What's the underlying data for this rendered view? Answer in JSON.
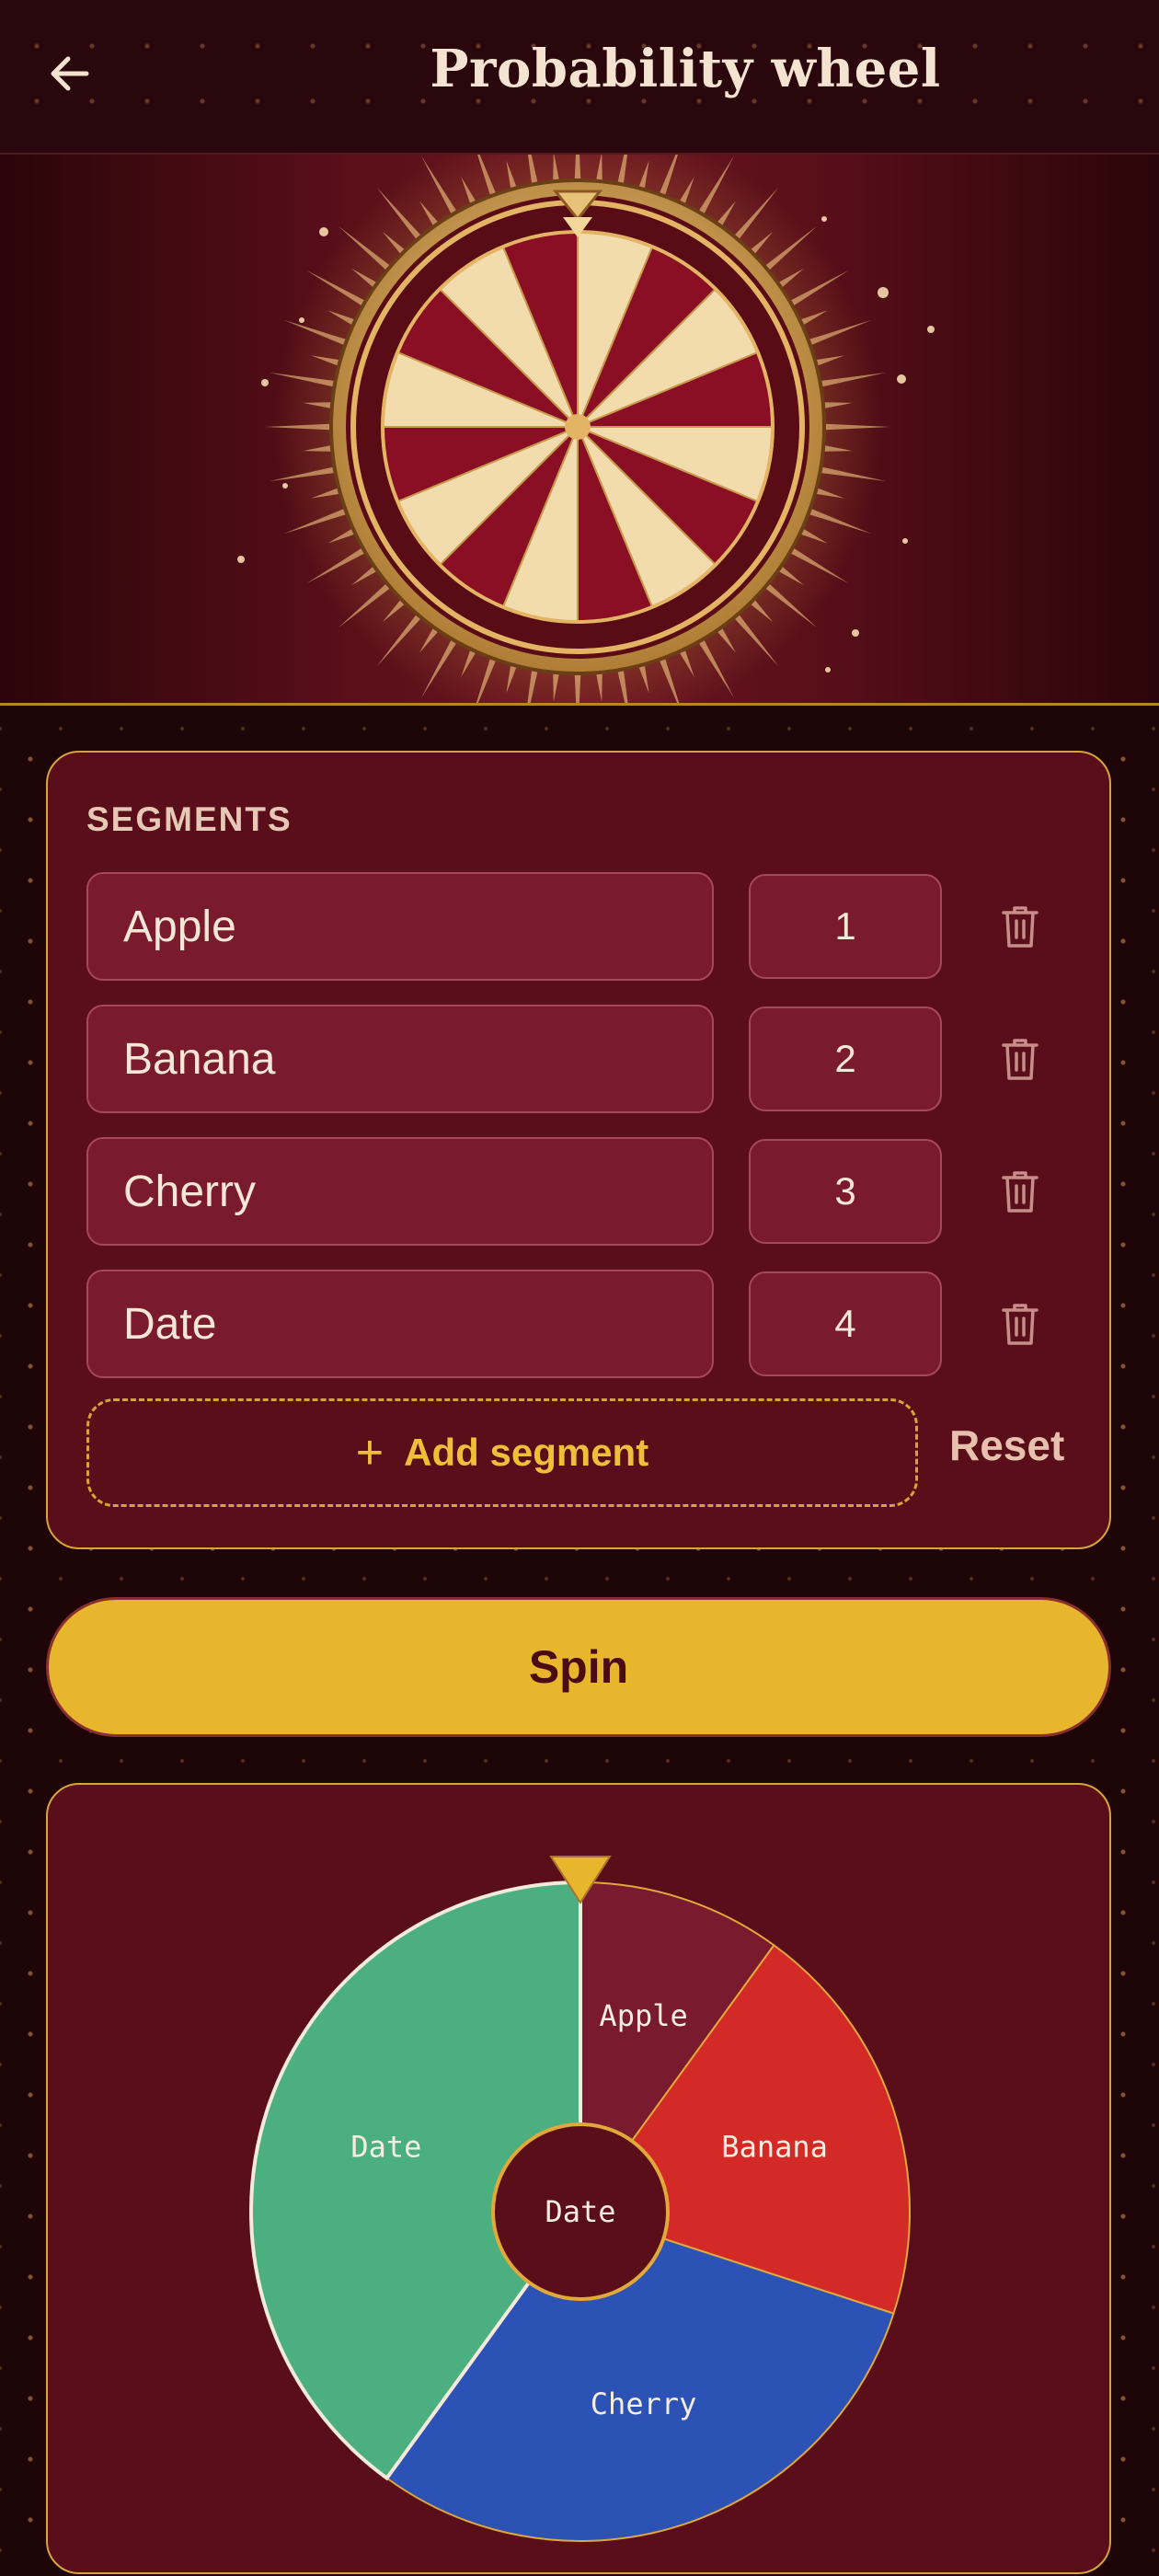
{
  "header": {
    "title": "Probability wheel",
    "back_icon": "arrow-left-icon"
  },
  "banner": {
    "description_icon": "decorative-wheel-illustration"
  },
  "segments": {
    "label": "SEGMENTS",
    "items": [
      {
        "name": "Apple",
        "weight": "1"
      },
      {
        "name": "Banana",
        "weight": "2"
      },
      {
        "name": "Cherry",
        "weight": "3"
      },
      {
        "name": "Date",
        "weight": "4"
      }
    ],
    "delete_icon": "trash-icon",
    "add_label": "Add segment",
    "add_icon": "plus-icon",
    "reset_label": "Reset"
  },
  "spin": {
    "label": "Spin"
  },
  "wheel": {
    "slices": [
      {
        "label": "Apple",
        "weight": 1,
        "color": "#7a1a2e"
      },
      {
        "label": "Banana",
        "weight": 2,
        "color": "#d42a27"
      },
      {
        "label": "Cherry",
        "weight": 3,
        "color": "#2b52b4"
      },
      {
        "label": "Date",
        "weight": 4,
        "color": "#4caf7f"
      }
    ],
    "center_label": "Date"
  },
  "colors": {
    "accent": "#e8b62c",
    "card_bg": "#5a0e19",
    "card_border": "#d6a43a",
    "input_bg": "#791a2d"
  }
}
